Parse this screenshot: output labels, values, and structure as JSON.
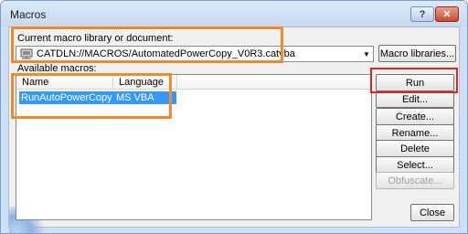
{
  "window": {
    "title": "Macros",
    "help_label": "?",
    "close_glyph": "✕"
  },
  "library": {
    "label": "Current macro library or document:",
    "value": "CATDLN://MACROS/AutomatedPowerCopy_V0R3.catvba",
    "icon": "network-library-icon",
    "button": "Macro libraries..."
  },
  "macros": {
    "label": "Available macros:",
    "columns": [
      "Name",
      "Language"
    ],
    "rows": [
      {
        "name": "RunAutoPowerCopy",
        "language": "MS VBA",
        "selected": true
      }
    ]
  },
  "actions": {
    "run": "Run",
    "edit": "Edit...",
    "create": "Create...",
    "rename": "Rename...",
    "delete": "Delete",
    "select": "Select...",
    "obfuscate": "Obfuscate...",
    "close": "Close"
  },
  "colors": {
    "selection": "#3399ff",
    "annotation_orange": "#f28a2c",
    "annotation_red": "#e0251b"
  }
}
